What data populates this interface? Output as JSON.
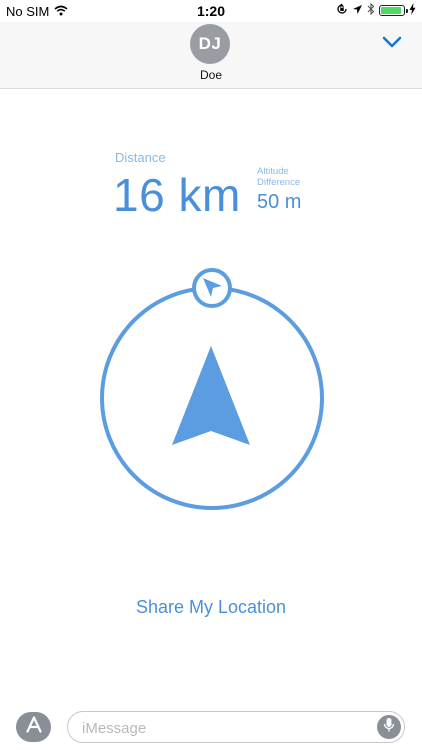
{
  "status_bar": {
    "carrier": "No SIM",
    "time": "1:20",
    "battery_level": 0.9,
    "icons": [
      "wifi-icon",
      "orientation-lock-icon",
      "location-arrow-icon",
      "bluetooth-icon",
      "battery-icon",
      "charging-bolt-icon"
    ]
  },
  "header": {
    "avatar_initials": "DJ",
    "contact_name": "Doe",
    "collapse_icon": "chevron-down-icon"
  },
  "location": {
    "distance_label": "Distance",
    "distance_value": "16 km",
    "altitude_label_line1": "Altitude",
    "altitude_label_line2": "Difference",
    "altitude_value": "50 m",
    "compass_icons": [
      "compass-ring",
      "direction-arrow-icon",
      "bearing-marker-icon"
    ]
  },
  "share_label": "Share My Location",
  "input_bar": {
    "placeholder": "iMessage",
    "value": "",
    "apps_icon": "app-store-icon",
    "mic_icon": "microphone-icon"
  },
  "colors": {
    "accent": "#4a90d9",
    "accent_light": "#8ab8e6",
    "compass": "#5b9de0",
    "ios_blue": "#1a73d6",
    "header_bg": "#f7f7f7",
    "avatar_bg": "#9a9ca3",
    "battery_green": "#4cd964"
  }
}
